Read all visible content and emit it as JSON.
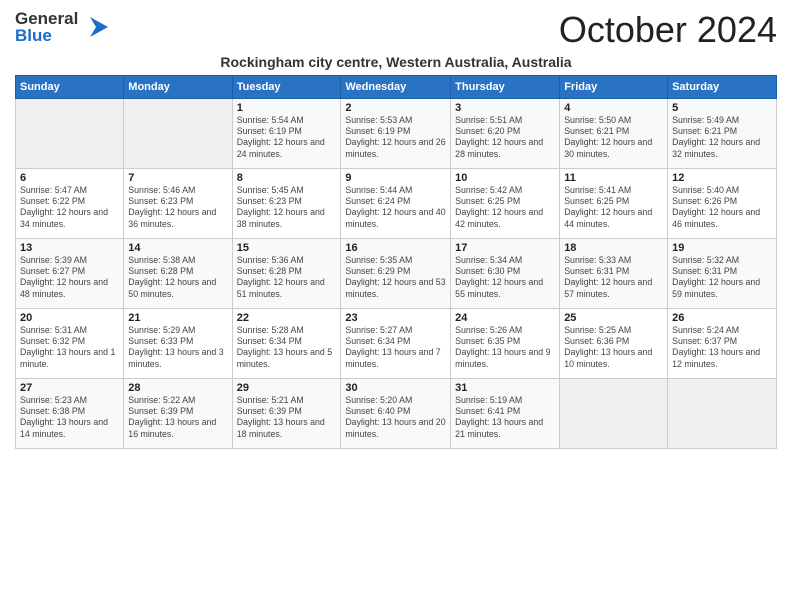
{
  "header": {
    "logo_line1": "General",
    "logo_line2": "Blue",
    "month_title": "October 2024",
    "subtitle": "Rockingham city centre, Western Australia, Australia"
  },
  "weekdays": [
    "Sunday",
    "Monday",
    "Tuesday",
    "Wednesday",
    "Thursday",
    "Friday",
    "Saturday"
  ],
  "weeks": [
    [
      {
        "day": "",
        "sunrise": "",
        "sunset": "",
        "daylight": ""
      },
      {
        "day": "",
        "sunrise": "",
        "sunset": "",
        "daylight": ""
      },
      {
        "day": "1",
        "sunrise": "Sunrise: 5:54 AM",
        "sunset": "Sunset: 6:19 PM",
        "daylight": "Daylight: 12 hours and 24 minutes."
      },
      {
        "day": "2",
        "sunrise": "Sunrise: 5:53 AM",
        "sunset": "Sunset: 6:19 PM",
        "daylight": "Daylight: 12 hours and 26 minutes."
      },
      {
        "day": "3",
        "sunrise": "Sunrise: 5:51 AM",
        "sunset": "Sunset: 6:20 PM",
        "daylight": "Daylight: 12 hours and 28 minutes."
      },
      {
        "day": "4",
        "sunrise": "Sunrise: 5:50 AM",
        "sunset": "Sunset: 6:21 PM",
        "daylight": "Daylight: 12 hours and 30 minutes."
      },
      {
        "day": "5",
        "sunrise": "Sunrise: 5:49 AM",
        "sunset": "Sunset: 6:21 PM",
        "daylight": "Daylight: 12 hours and 32 minutes."
      }
    ],
    [
      {
        "day": "6",
        "sunrise": "Sunrise: 5:47 AM",
        "sunset": "Sunset: 6:22 PM",
        "daylight": "Daylight: 12 hours and 34 minutes."
      },
      {
        "day": "7",
        "sunrise": "Sunrise: 5:46 AM",
        "sunset": "Sunset: 6:23 PM",
        "daylight": "Daylight: 12 hours and 36 minutes."
      },
      {
        "day": "8",
        "sunrise": "Sunrise: 5:45 AM",
        "sunset": "Sunset: 6:23 PM",
        "daylight": "Daylight: 12 hours and 38 minutes."
      },
      {
        "day": "9",
        "sunrise": "Sunrise: 5:44 AM",
        "sunset": "Sunset: 6:24 PM",
        "daylight": "Daylight: 12 hours and 40 minutes."
      },
      {
        "day": "10",
        "sunrise": "Sunrise: 5:42 AM",
        "sunset": "Sunset: 6:25 PM",
        "daylight": "Daylight: 12 hours and 42 minutes."
      },
      {
        "day": "11",
        "sunrise": "Sunrise: 5:41 AM",
        "sunset": "Sunset: 6:25 PM",
        "daylight": "Daylight: 12 hours and 44 minutes."
      },
      {
        "day": "12",
        "sunrise": "Sunrise: 5:40 AM",
        "sunset": "Sunset: 6:26 PM",
        "daylight": "Daylight: 12 hours and 46 minutes."
      }
    ],
    [
      {
        "day": "13",
        "sunrise": "Sunrise: 5:39 AM",
        "sunset": "Sunset: 6:27 PM",
        "daylight": "Daylight: 12 hours and 48 minutes."
      },
      {
        "day": "14",
        "sunrise": "Sunrise: 5:38 AM",
        "sunset": "Sunset: 6:28 PM",
        "daylight": "Daylight: 12 hours and 50 minutes."
      },
      {
        "day": "15",
        "sunrise": "Sunrise: 5:36 AM",
        "sunset": "Sunset: 6:28 PM",
        "daylight": "Daylight: 12 hours and 51 minutes."
      },
      {
        "day": "16",
        "sunrise": "Sunrise: 5:35 AM",
        "sunset": "Sunset: 6:29 PM",
        "daylight": "Daylight: 12 hours and 53 minutes."
      },
      {
        "day": "17",
        "sunrise": "Sunrise: 5:34 AM",
        "sunset": "Sunset: 6:30 PM",
        "daylight": "Daylight: 12 hours and 55 minutes."
      },
      {
        "day": "18",
        "sunrise": "Sunrise: 5:33 AM",
        "sunset": "Sunset: 6:31 PM",
        "daylight": "Daylight: 12 hours and 57 minutes."
      },
      {
        "day": "19",
        "sunrise": "Sunrise: 5:32 AM",
        "sunset": "Sunset: 6:31 PM",
        "daylight": "Daylight: 12 hours and 59 minutes."
      }
    ],
    [
      {
        "day": "20",
        "sunrise": "Sunrise: 5:31 AM",
        "sunset": "Sunset: 6:32 PM",
        "daylight": "Daylight: 13 hours and 1 minute."
      },
      {
        "day": "21",
        "sunrise": "Sunrise: 5:29 AM",
        "sunset": "Sunset: 6:33 PM",
        "daylight": "Daylight: 13 hours and 3 minutes."
      },
      {
        "day": "22",
        "sunrise": "Sunrise: 5:28 AM",
        "sunset": "Sunset: 6:34 PM",
        "daylight": "Daylight: 13 hours and 5 minutes."
      },
      {
        "day": "23",
        "sunrise": "Sunrise: 5:27 AM",
        "sunset": "Sunset: 6:34 PM",
        "daylight": "Daylight: 13 hours and 7 minutes."
      },
      {
        "day": "24",
        "sunrise": "Sunrise: 5:26 AM",
        "sunset": "Sunset: 6:35 PM",
        "daylight": "Daylight: 13 hours and 9 minutes."
      },
      {
        "day": "25",
        "sunrise": "Sunrise: 5:25 AM",
        "sunset": "Sunset: 6:36 PM",
        "daylight": "Daylight: 13 hours and 10 minutes."
      },
      {
        "day": "26",
        "sunrise": "Sunrise: 5:24 AM",
        "sunset": "Sunset: 6:37 PM",
        "daylight": "Daylight: 13 hours and 12 minutes."
      }
    ],
    [
      {
        "day": "27",
        "sunrise": "Sunrise: 5:23 AM",
        "sunset": "Sunset: 6:38 PM",
        "daylight": "Daylight: 13 hours and 14 minutes."
      },
      {
        "day": "28",
        "sunrise": "Sunrise: 5:22 AM",
        "sunset": "Sunset: 6:39 PM",
        "daylight": "Daylight: 13 hours and 16 minutes."
      },
      {
        "day": "29",
        "sunrise": "Sunrise: 5:21 AM",
        "sunset": "Sunset: 6:39 PM",
        "daylight": "Daylight: 13 hours and 18 minutes."
      },
      {
        "day": "30",
        "sunrise": "Sunrise: 5:20 AM",
        "sunset": "Sunset: 6:40 PM",
        "daylight": "Daylight: 13 hours and 20 minutes."
      },
      {
        "day": "31",
        "sunrise": "Sunrise: 5:19 AM",
        "sunset": "Sunset: 6:41 PM",
        "daylight": "Daylight: 13 hours and 21 minutes."
      },
      {
        "day": "",
        "sunrise": "",
        "sunset": "",
        "daylight": ""
      },
      {
        "day": "",
        "sunrise": "",
        "sunset": "",
        "daylight": ""
      }
    ]
  ]
}
